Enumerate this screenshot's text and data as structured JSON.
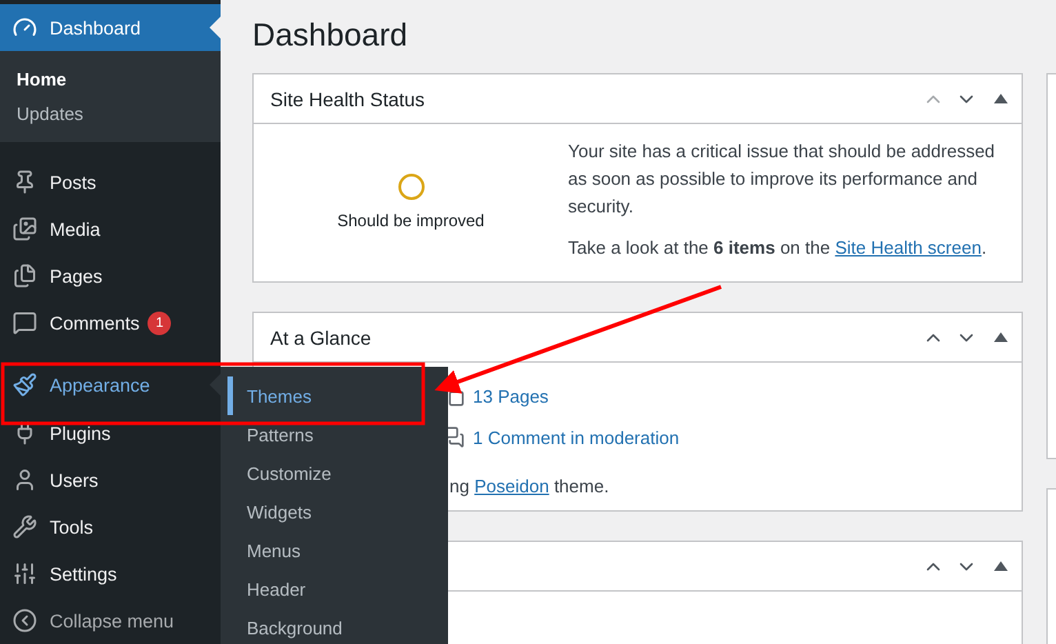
{
  "sidebar": {
    "items": [
      {
        "label": "Dashboard",
        "selected": true,
        "hovered": false,
        "children": [
          {
            "label": "Home",
            "selected": true
          },
          {
            "label": "Updates",
            "selected": false
          }
        ]
      },
      {
        "label": "Posts",
        "selected": false,
        "hovered": false
      },
      {
        "label": "Media",
        "selected": false,
        "hovered": false
      },
      {
        "label": "Pages",
        "selected": false,
        "hovered": false
      },
      {
        "label": "Comments",
        "selected": false,
        "hovered": false,
        "badge": "1"
      },
      {
        "label": "Appearance",
        "selected": false,
        "hovered": true
      },
      {
        "label": "Plugins",
        "selected": false,
        "hovered": false
      },
      {
        "label": "Users",
        "selected": false,
        "hovered": false
      },
      {
        "label": "Tools",
        "selected": false,
        "hovered": false
      },
      {
        "label": "Settings",
        "selected": false,
        "hovered": false
      }
    ],
    "collapse": "Collapse menu"
  },
  "flyout": {
    "items": [
      {
        "label": "Themes",
        "selected": true
      },
      {
        "label": "Patterns",
        "selected": false
      },
      {
        "label": "Customize",
        "selected": false
      },
      {
        "label": "Widgets",
        "selected": false
      },
      {
        "label": "Menus",
        "selected": false
      },
      {
        "label": "Header",
        "selected": false
      },
      {
        "label": "Background",
        "selected": false
      }
    ]
  },
  "page_title": "Dashboard",
  "panels": [
    {
      "kind": "health",
      "title": "Site Health Status",
      "up_disabled": true,
      "status": "Should be improved",
      "message": "Your site has a critical issue that should be addressed as soon as possible to improve its performance and security.",
      "hint_before": "Take a look at the **6 items** on the",
      "hint_link": "Site Health screen",
      "hint_after": "."
    },
    {
      "kind": "glance",
      "title": "At a Glance",
      "up_disabled": false,
      "stats": [
        "13 Pages",
        "1 Comment in moderation"
      ],
      "theme_before": "ng",
      "theme_link": "Poseidon",
      "theme_after": "theme."
    },
    {
      "kind": "blank",
      "up_disabled": false
    }
  ]
}
